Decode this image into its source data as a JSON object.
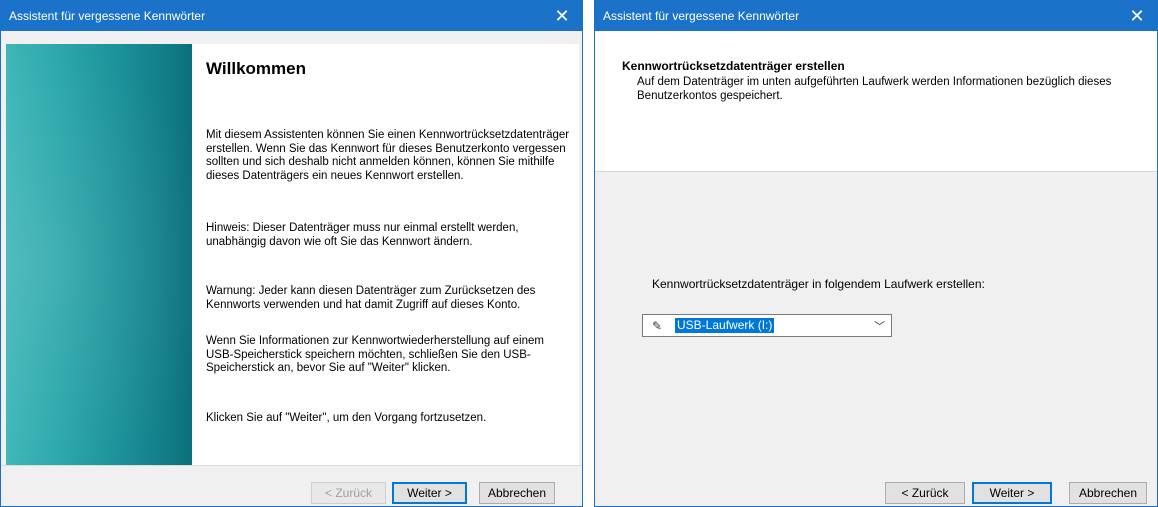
{
  "welcome_dialog": {
    "title": "Assistent für vergessene Kennwörter",
    "heading": "Willkommen",
    "para_intro": "Mit diesem Assistenten können Sie einen Kennwortrücksetzdatenträger erstellen. Wenn Sie das Kennwort für dieses Benutzerkonto vergessen sollten und sich deshalb nicht anmelden können, können Sie mithilfe dieses Datenträgers ein neues Kennwort erstellen.",
    "para_hint": "Hinweis: Dieser Datenträger muss nur einmal erstellt werden, unabhängig davon wie oft Sie das Kennwort ändern.",
    "para_warning": "Warnung: Jeder kann diesen Datenträger zum Zurücksetzen des Kennworts verwenden und hat damit Zugriff auf dieses Konto.",
    "para_usb": "Wenn Sie Informationen zur Kennwortwiederherstellung auf einem USB-Speicherstick speichern möchten, schließen Sie den USB-Speicherstick an, bevor Sie auf \"Weiter\" klicken.",
    "para_continue": "Klicken Sie auf \"Weiter\", um den Vorgang fortzusetzen.",
    "buttons": {
      "back": "< Zurück",
      "next": "Weiter >",
      "cancel": "Abbrechen"
    }
  },
  "create_dialog": {
    "title": "Assistent für vergessene Kennwörter",
    "heading": "Kennwortrücksetzdatenträger erstellen",
    "description": "Auf dem Datenträger im unten aufgeführten Laufwerk werden Informationen bezüglich dieses Benutzerkontos gespeichert.",
    "drive_label": "Kennwortrücksetzdatenträger in folgendem Laufwerk erstellen:",
    "drive_selected": "USB-Laufwerk (I:)",
    "buttons": {
      "back": "< Zurück",
      "next": "Weiter >",
      "cancel": "Abbrechen"
    }
  },
  "icons": {
    "close": "close-icon",
    "drive": "usb-drive-icon",
    "dropdown": "chevron-down-icon"
  }
}
